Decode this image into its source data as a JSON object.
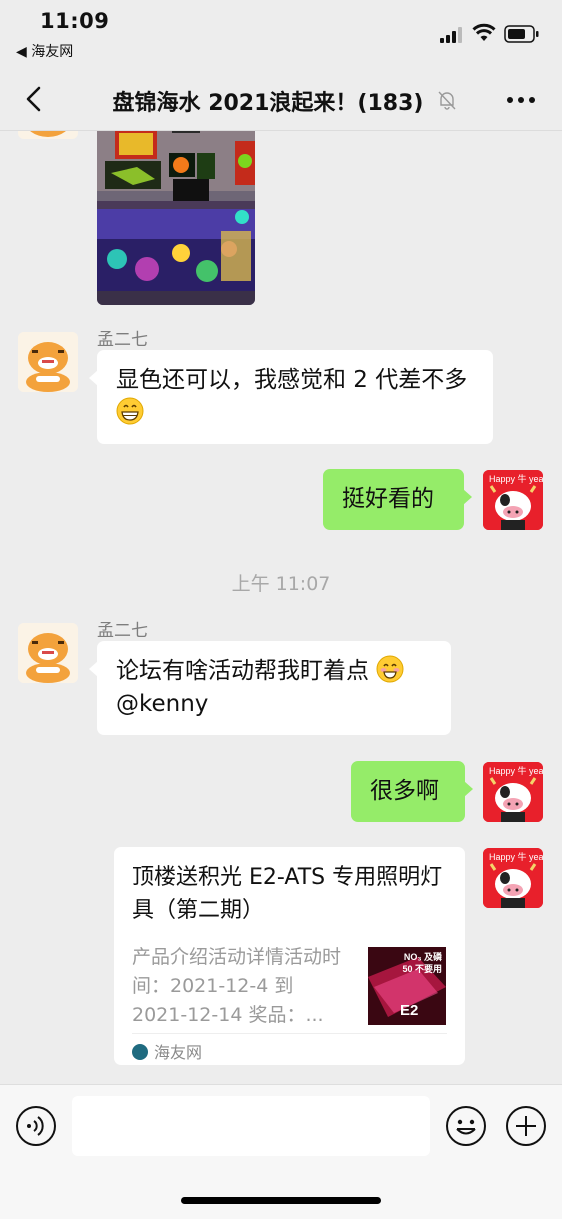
{
  "status_bar": {
    "time": "11:09",
    "back_app": "◀ 海友网"
  },
  "nav": {
    "title": "盘锦海水 2021浪起来！(183)"
  },
  "messages": [
    {
      "sender": "孟二七",
      "text": "显色还可以，我感觉和 2 代差不多"
    },
    {
      "self_text": "挺好看的"
    },
    {
      "timestamp": "上午 11:07"
    },
    {
      "sender": "孟二七",
      "text": "论坛有啥活动帮我盯着点",
      "mention": "@kenny"
    },
    {
      "self_text": "很多啊"
    }
  ],
  "link_card": {
    "title": "顶楼送积光 E2-ATS 专用照明灯具（第二期）",
    "desc": "产品介绍活动详情活动时间：2021-12-4 到 2021-12-14 奖品：...",
    "source": "海友网",
    "thumb_line1": "NO₃ 及磷",
    "thumb_line2": "50 不要用",
    "thumb_brand": "E2"
  },
  "colors": {
    "background": "#ededed",
    "self_bubble": "#95ec69",
    "other_bubble": "#ffffff"
  },
  "icons": [
    "chevron-left-icon",
    "mute-bell-icon",
    "more-icon",
    "voice-icon",
    "emoji-icon",
    "plus-icon"
  ]
}
